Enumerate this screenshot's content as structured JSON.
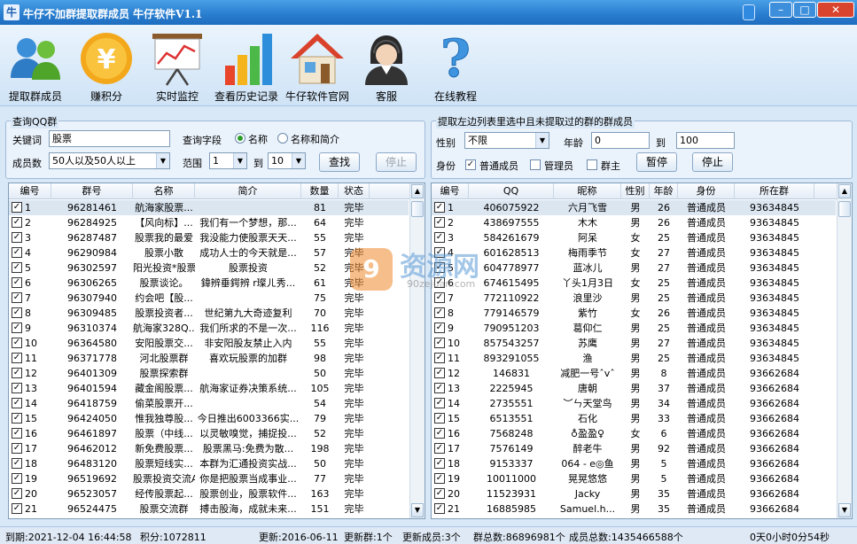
{
  "window": {
    "app_icon_text": "牛",
    "title": "牛仔不加群提取群成员 牛仔软件V1.1"
  },
  "toolbar": [
    {
      "label": "提取群成员",
      "icon": "users-icon"
    },
    {
      "label": "赚积分",
      "icon": "yen-coin-icon"
    },
    {
      "label": "实时监控",
      "icon": "chart-board-icon"
    },
    {
      "label": "查看历史记录",
      "icon": "bar-chart-icon"
    },
    {
      "label": "牛仔软件官网",
      "icon": "home-icon"
    },
    {
      "label": "客服",
      "icon": "support-agent-icon"
    },
    {
      "label": "在线教程",
      "icon": "help-question-icon"
    }
  ],
  "colors": {
    "titlebar": "#2a7fd0",
    "check_green": "#2a9d2a",
    "close_red": "#d9442e"
  },
  "query": {
    "legend": "查询QQ群",
    "keyword_label": "关键词",
    "keyword_value": "股票",
    "field_label": "查询字段",
    "field_name": "名称",
    "field_name_intro": "名称和简介",
    "members_label": "成员数",
    "members_value": "50人以及50人以上",
    "range_label": "范围",
    "range_from": "1",
    "range_to_label": "到",
    "range_to": "10",
    "search_button": "查找",
    "stop_button": "停止"
  },
  "extract": {
    "legend": "提取左边列表里选中且未提取过的群的群成员",
    "gender_label": "性别",
    "gender_value": "不限",
    "age_label": "年龄",
    "age_from": "0",
    "age_to_label": "到",
    "age_to": "100",
    "identity_label": "身份",
    "normal": "普通成员",
    "admin": "管理员",
    "owner": "群主",
    "pause_button": "暂停",
    "stop_button": "停止"
  },
  "groups": {
    "columns": [
      "编号",
      "群号",
      "名称",
      "简介",
      "数量",
      "状态"
    ],
    "rows": [
      [
        "1",
        "96281461",
        "航海家股票...",
        "",
        "81",
        "完毕"
      ],
      [
        "2",
        "96284925",
        "【风向标】...",
        "我们有一个梦想，那...",
        "64",
        "完毕"
      ],
      [
        "3",
        "96287487",
        "股票我的最爱",
        "我没能力使股票天天...",
        "55",
        "完毕"
      ],
      [
        "4",
        "96290984",
        "股票小散",
        "成功人士的今天就是...",
        "57",
        "完毕"
      ],
      [
        "5",
        "96302597",
        "阳光投资*股票",
        "股票投资",
        "52",
        "完毕"
      ],
      [
        "6",
        "96306265",
        "股票谈论。",
        "鍏辨垂鍔辨 r璨ㄦ秀...",
        "61",
        "完毕"
      ],
      [
        "7",
        "96307940",
        "约会吧【股...",
        "",
        "75",
        "完毕"
      ],
      [
        "8",
        "96309485",
        "股票投资者...",
        "世纪第九大奇迹复利",
        "70",
        "完毕"
      ],
      [
        "9",
        "96310374",
        "航海家328Q...",
        "我们所求的不是一次...",
        "116",
        "完毕"
      ],
      [
        "10",
        "96364580",
        "安阳股票交...",
        "非安阳股友禁止入内",
        "55",
        "完毕"
      ],
      [
        "11",
        "96371778",
        "河北股票群",
        "喜欢玩股票的加群",
        "98",
        "完毕"
      ],
      [
        "12",
        "96401309",
        "股票探索群",
        "",
        "50",
        "完毕"
      ],
      [
        "13",
        "96401594",
        "藏金阁股票...",
        "航海家证券决策系统...",
        "105",
        "完毕"
      ],
      [
        "14",
        "96418759",
        "偷菜股票开...",
        "",
        "54",
        "完毕"
      ],
      [
        "15",
        "96424050",
        "惟我独尊股...",
        "今日推出6003366实...",
        "79",
        "完毕"
      ],
      [
        "16",
        "96461897",
        "股票（中线...",
        "以灵敏嗅觉，捕捉投...",
        "52",
        "完毕"
      ],
      [
        "17",
        "96462012",
        "新免费股票...",
        "股票黑马:免费为散...",
        "198",
        "完毕"
      ],
      [
        "18",
        "96483120",
        "股票短线实...",
        "本群为汇通投资实战...",
        "50",
        "完毕"
      ],
      [
        "19",
        "96519692",
        "股票投资交流A",
        "你是把股票当成事业...",
        "77",
        "完毕"
      ],
      [
        "20",
        "96523057",
        "经传股票起...",
        "股票创业，股票软件...",
        "163",
        "完毕"
      ],
      [
        "21",
        "96524475",
        "股票交流群",
        "搏击股海，成就未来...",
        "151",
        "完毕"
      ]
    ]
  },
  "members": {
    "columns": [
      "编号",
      "QQ",
      "昵称",
      "性别",
      "年龄",
      "身份",
      "所在群"
    ],
    "rows": [
      [
        "1",
        "406075922",
        "六月飞雪",
        "男",
        "26",
        "普通成员",
        "93634845"
      ],
      [
        "2",
        "438697555",
        "木木",
        "男",
        "26",
        "普通成员",
        "93634845"
      ],
      [
        "3",
        "584261679",
        "阿呆",
        "女",
        "25",
        "普通成员",
        "93634845"
      ],
      [
        "4",
        "601628513",
        "梅雨季节",
        "女",
        "27",
        "普通成员",
        "93634845"
      ],
      [
        "5",
        "604778977",
        "蓝冰儿",
        "男",
        "27",
        "普通成员",
        "93634845"
      ],
      [
        "6",
        "674615495",
        "丫头1月3日",
        "女",
        "25",
        "普通成员",
        "93634845"
      ],
      [
        "7",
        "772110922",
        "浪里沙",
        "男",
        "25",
        "普通成员",
        "93634845"
      ],
      [
        "8",
        "779146579",
        "紫竹",
        "女",
        "26",
        "普通成员",
        "93634845"
      ],
      [
        "9",
        "790951203",
        "葛仰仁",
        "男",
        "25",
        "普通成员",
        "93634845"
      ],
      [
        "10",
        "857543257",
        "苏鹰",
        "男",
        "27",
        "普通成员",
        "93634845"
      ],
      [
        "11",
        "893291055",
        "渔",
        "男",
        "25",
        "普通成员",
        "93634845"
      ],
      [
        "12",
        "146831",
        "减肥一号ˆvˆ",
        "男",
        "8",
        "普通成员",
        "93662684"
      ],
      [
        "13",
        "2225945",
        "唐朝",
        "男",
        "37",
        "普通成员",
        "93662684"
      ],
      [
        "14",
        "2735551",
        "︶ㄣ天堂鸟",
        "男",
        "34",
        "普通成员",
        "93662684"
      ],
      [
        "15",
        "6513551",
        "石化",
        "男",
        "33",
        "普通成员",
        "93662684"
      ],
      [
        "16",
        "7568248",
        "♁盈盈♀",
        "女",
        "6",
        "普通成员",
        "93662684"
      ],
      [
        "17",
        "7576149",
        "醉老牛",
        "男",
        "92",
        "普通成员",
        "93662684"
      ],
      [
        "18",
        "9153337",
        "064 - e◎鱼",
        "男",
        "5",
        "普通成员",
        "93662684"
      ],
      [
        "19",
        "10011000",
        "晃晃悠悠",
        "男",
        "5",
        "普通成员",
        "93662684"
      ],
      [
        "20",
        "11523931",
        "Jacky",
        "男",
        "35",
        "普通成员",
        "93662684"
      ],
      [
        "21",
        "16885985",
        "Samuel.h...",
        "男",
        "35",
        "普通成员",
        "93662684"
      ]
    ]
  },
  "status": {
    "expiry": "到期:2021-12-04 16:44:58",
    "points": "积分:1072811",
    "update": "更新:2016-06-11",
    "updated_groups": "更新群:1个",
    "updated_members": "更新成员:3个",
    "total_groups": "群总数:86896981个",
    "total_members": "成员总数:1435466588个",
    "elapsed": "0天0小时0分54秒"
  },
  "watermark": {
    "logo": "9",
    "name": "资源网",
    "url": "90zejuan.com"
  }
}
